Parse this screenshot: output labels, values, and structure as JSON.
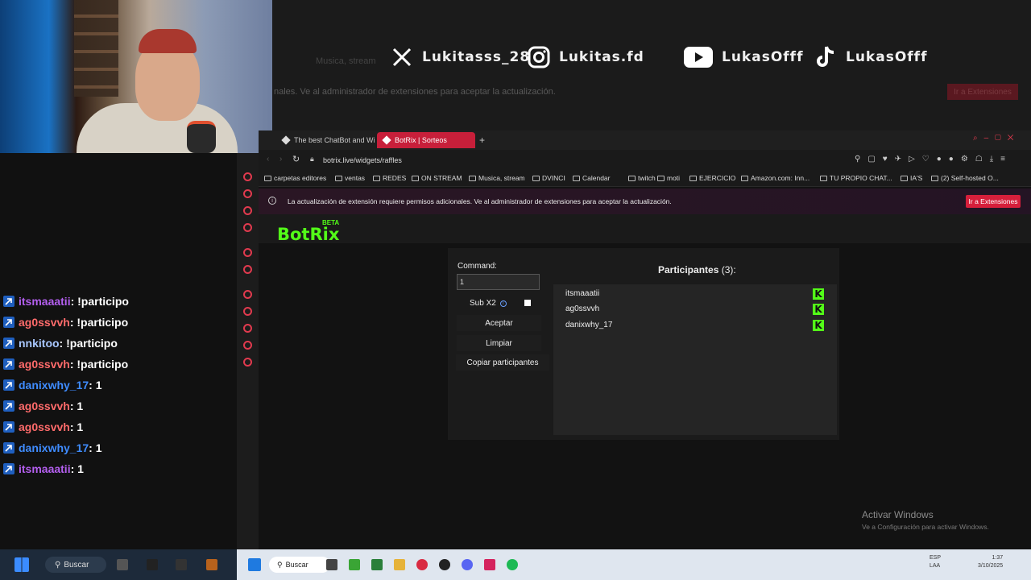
{
  "background_browser": {
    "ghost_tab": "Musica, stream",
    "ghost_notice": "nales. Ve al administrador de extensiones para aceptar la actualización.",
    "ghost_button": "Ir a Extensiones"
  },
  "socials": [
    {
      "icon": "x-logo-icon",
      "handle": "Lukitasss_28"
    },
    {
      "icon": "instagram-icon",
      "handle": "Lukitas.fd"
    },
    {
      "icon": "youtube-icon",
      "handle": "LukasOfff"
    },
    {
      "icon": "tiktok-icon",
      "handle": "LukasOfff"
    }
  ],
  "chat": {
    "messages": [
      {
        "user": "itsmaaatii",
        "color": "#b45ff0",
        "text": " : !participo"
      },
      {
        "user": "ag0ssvvh",
        "color": "#ff6b6b",
        "text": " : !participo"
      },
      {
        "user": "nnkitoo",
        "color": "#a9c8ff",
        "text": " : !participo"
      },
      {
        "user": "ag0ssvvh",
        "color": "#ff6b6b",
        "text": " : !participo"
      },
      {
        "user": "danixwhy_17",
        "color": "#3f8cff",
        "text": " : 1"
      },
      {
        "user": "ag0ssvvh",
        "color": "#ff6b6b",
        "text": " : 1"
      },
      {
        "user": "ag0ssvvh",
        "color": "#ff6b6b",
        "text": " : 1"
      },
      {
        "user": "danixwhy_17",
        "color": "#3f8cff",
        "text": " : 1"
      },
      {
        "user": "itsmaaatii",
        "color": "#b45ff0",
        "text": " : 1"
      }
    ]
  },
  "browser": {
    "tabs": [
      {
        "label": "The best ChatBot and Wi",
        "active": false
      },
      {
        "label": "BotRix | Sorteos",
        "active": true
      }
    ],
    "url": "botrix.live/widgets/raffles",
    "bookmarks": [
      "carpetas editores",
      "ventas",
      "REDES",
      "ON STREAM",
      "Musica, stream",
      "DVINCI",
      "Calendar",
      "twitch",
      "moti",
      "EJERCICIO",
      "Amazon.com: Inn...",
      "TU PROPIO CHAT...",
      "IA'S",
      "(2) Self-hosted O..."
    ],
    "info_bar": {
      "text": "La actualización de extensión requiere permisos adicionales. Ve al administrador de extensiones para aceptar la actualización.",
      "button": "Ir a Extensiones"
    }
  },
  "page": {
    "logo": "BotRix",
    "beta": "BETA",
    "raffle": {
      "command_label": "Command:",
      "command_value": "1",
      "sub_label": "Sub X2",
      "sub_info": "i",
      "sub_checked": false,
      "accept_button": "Aceptar",
      "clear_button": "Limpiar",
      "copy_button": "Copiar participantes",
      "participants_title": "Participantes",
      "participants_count": " (3):",
      "participants": [
        "itsmaaatii",
        "ag0ssvvh",
        "danixwhy_17"
      ],
      "platform_badge": "K"
    }
  },
  "windows_watermark": {
    "title": "Activar Windows",
    "subtitle": "Ve a Configuración para activar Windows."
  },
  "taskbar": {
    "search_left": "Buscar",
    "search_right": "Buscar",
    "lang": "ESP",
    "region": "LAA",
    "time": "1:37",
    "date": "3/10/2025"
  }
}
